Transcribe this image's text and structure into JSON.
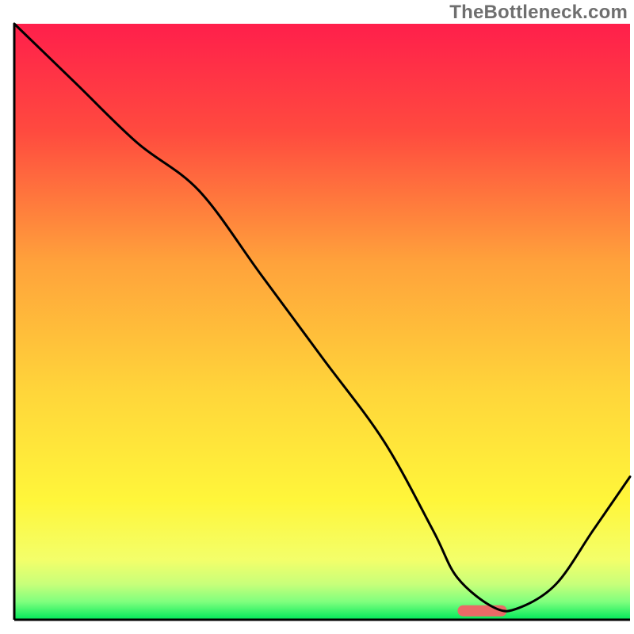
{
  "watermark": "TheBottleneck.com",
  "chart_data": {
    "type": "line",
    "title": "",
    "xlabel": "",
    "ylabel": "",
    "xlim": [
      0,
      100
    ],
    "ylim": [
      0,
      100
    ],
    "grid": false,
    "series": [
      {
        "name": "curve",
        "x": [
          0,
          10,
          20,
          30,
          40,
          50,
          60,
          68,
          72,
          78,
          82,
          88,
          94,
          100
        ],
        "y": [
          100,
          90,
          80,
          72,
          58,
          44,
          30,
          15,
          7,
          2,
          2,
          6,
          15,
          24
        ]
      }
    ],
    "marker": {
      "x_start": 72,
      "x_end": 80,
      "y": 1.5,
      "color": "#ea6a67"
    },
    "gradient_stops": [
      {
        "pct": 0,
        "color": "#ff1f4b"
      },
      {
        "pct": 18,
        "color": "#ff4a3f"
      },
      {
        "pct": 40,
        "color": "#ffa23b"
      },
      {
        "pct": 62,
        "color": "#ffd63a"
      },
      {
        "pct": 80,
        "color": "#fff63a"
      },
      {
        "pct": 90,
        "color": "#f3ff6a"
      },
      {
        "pct": 94,
        "color": "#c8ff7a"
      },
      {
        "pct": 97,
        "color": "#7fff7e"
      },
      {
        "pct": 100,
        "color": "#00e85a"
      }
    ],
    "frame": {
      "left_pad": 18,
      "right_pad": 5,
      "top_pad": 30,
      "bottom_pad": 18
    }
  }
}
